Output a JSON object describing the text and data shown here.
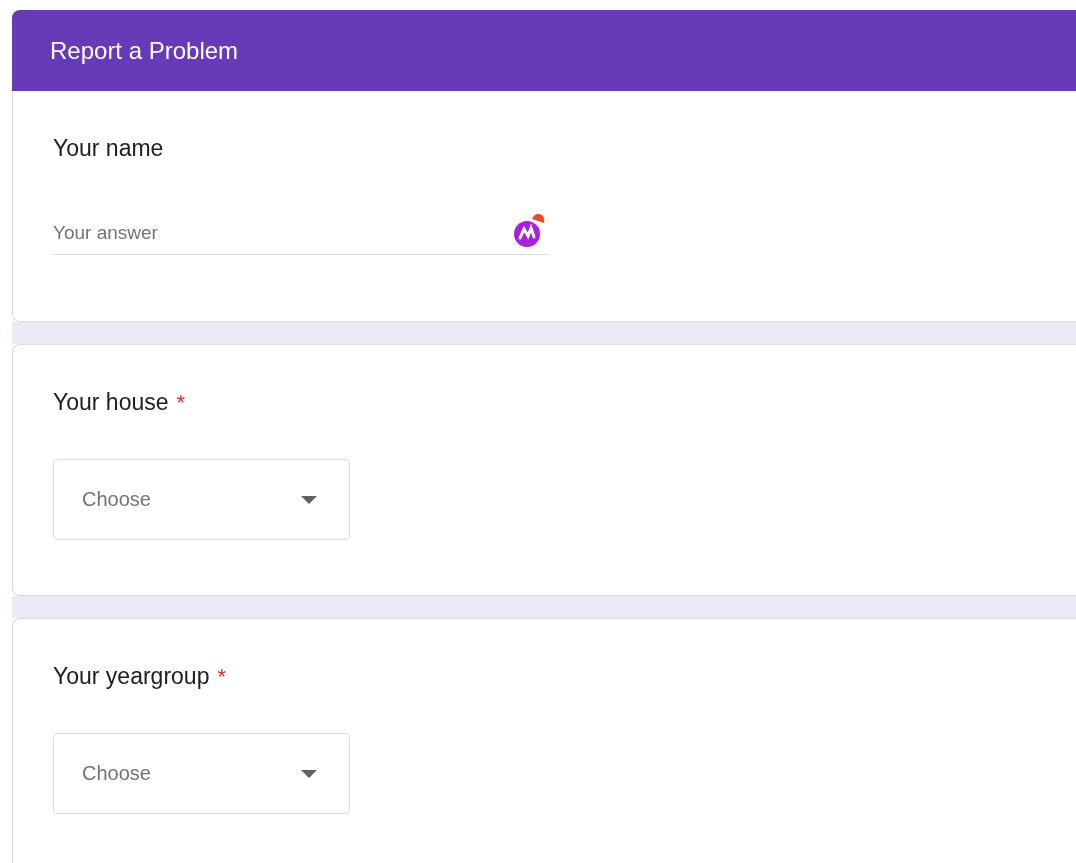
{
  "header": {
    "title": "Report a Problem"
  },
  "questions": [
    {
      "kind": "text",
      "label": "Your name",
      "placeholder": "Your answer"
    },
    {
      "kind": "dropdown",
      "label": "Your house",
      "required_mark": "*",
      "placeholder": "Choose"
    },
    {
      "kind": "dropdown",
      "label": "Your yeargroup",
      "required_mark": "*",
      "placeholder": "Choose"
    }
  ]
}
